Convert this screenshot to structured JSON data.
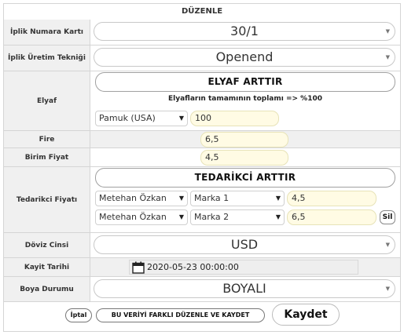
{
  "header": {
    "title": "DÜZENLE"
  },
  "fields": {
    "iplik_numara": {
      "label": "İplik Numara Kartı",
      "value": "30/1"
    },
    "iplik_uretim": {
      "label": "İplik Üretim Tekniği",
      "value": "Openend"
    },
    "elyaf": {
      "label": "Elyaf",
      "add_button": "ELYAF ARTTIR",
      "note": "Elyafların tamamının toplamı => %100",
      "rows": [
        {
          "type": "Pamuk (USA)",
          "percent": "100"
        }
      ]
    },
    "fire": {
      "label": "Fire",
      "value": "6,5"
    },
    "birim_fiyat": {
      "label": "Birim Fiyat",
      "value": "4,5"
    },
    "tedarikci": {
      "label": "Tedarikci Fiyatı",
      "add_button": "TEDARİKCİ ARTTIR",
      "rows": [
        {
          "supplier": "Metehan Özkan",
          "brand": "Marka 1",
          "price": "4,5"
        },
        {
          "supplier": "Metehan Özkan",
          "brand": "Marka 2",
          "price": "6,5",
          "remove_label": "Sil"
        }
      ]
    },
    "doviz": {
      "label": "Döviz Cinsi",
      "value": "USD"
    },
    "kayit": {
      "label": "Kayit Tarihi",
      "value": "2020-05-23 00:00:00"
    },
    "boya": {
      "label": "Boya Durumu",
      "value": "BOYALI"
    }
  },
  "footer": {
    "cancel_label": "İptal",
    "duplicate_label": "BU VERİYİ FARKLI DÜZENLE VE KAYDET",
    "save_label": "Kaydet"
  },
  "icons": {
    "select_caret": "caret-down-icon",
    "calendar": "calendar-icon"
  }
}
